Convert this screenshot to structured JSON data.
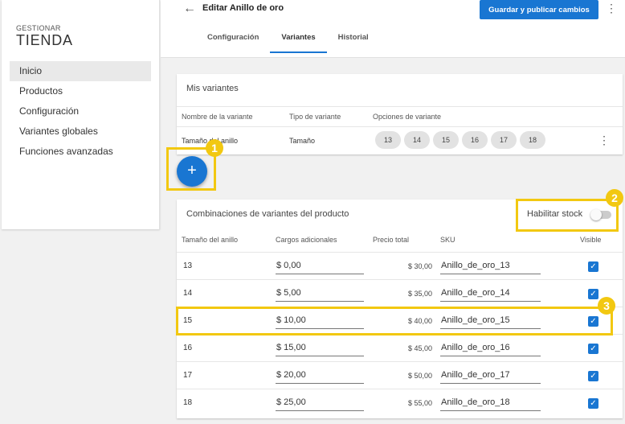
{
  "sidebar": {
    "brand_small": "GESTIONAR",
    "brand_big": "TIENDA",
    "items": [
      {
        "label": "Inicio"
      },
      {
        "label": "Productos"
      },
      {
        "label": "Configuración"
      },
      {
        "label": "Variantes globales"
      },
      {
        "label": "Funciones avanzadas"
      }
    ]
  },
  "header": {
    "back_icon": "arrow-left-icon",
    "title": "Editar Anillo de oro",
    "save_label": "Guardar y publicar cambios",
    "more_icon": "more-vertical-icon",
    "tabs": [
      {
        "label": "Configuración"
      },
      {
        "label": "Variantes"
      },
      {
        "label": "Historial"
      }
    ],
    "active_tab": "Variantes"
  },
  "variants_card": {
    "title": "Mis variantes",
    "columns": [
      "Nombre de la variante",
      "Tipo de variante",
      "Opciones de variante"
    ],
    "row": {
      "name": "Tamaño del anillo",
      "type": "Tamaño",
      "options": [
        "13",
        "14",
        "15",
        "16",
        "17",
        "18"
      ]
    }
  },
  "fab_icon": "plus-icon",
  "combinations_card": {
    "title": "Combinaciones de variantes del producto",
    "stock_label": "Habilitar stock",
    "stock_enabled": false,
    "columns": [
      "Tamaño del anillo",
      "Cargos adicionales",
      "Precio total",
      "SKU",
      "Visible"
    ],
    "rows": [
      {
        "size": "13",
        "charge": "$ 0,00",
        "price": "$ 30,00",
        "sku": "Anillo_de_oro_13",
        "visible": true
      },
      {
        "size": "14",
        "charge": "$ 5,00",
        "price": "$ 35,00",
        "sku": "Anillo_de_oro_14",
        "visible": true
      },
      {
        "size": "15",
        "charge": "$ 10,00",
        "price": "$ 40,00",
        "sku": "Anillo_de_oro_15",
        "visible": true
      },
      {
        "size": "16",
        "charge": "$ 15,00",
        "price": "$ 45,00",
        "sku": "Anillo_de_oro_16",
        "visible": true
      },
      {
        "size": "17",
        "charge": "$ 20,00",
        "price": "$ 50,00",
        "sku": "Anillo_de_oro_17",
        "visible": true
      },
      {
        "size": "18",
        "charge": "$ 25,00",
        "price": "$ 55,00",
        "sku": "Anillo_de_oro_18",
        "visible": true
      }
    ]
  },
  "callouts": [
    "1",
    "2",
    "3"
  ],
  "colors": {
    "accent": "#1976d2",
    "callout": "#f2c811"
  }
}
